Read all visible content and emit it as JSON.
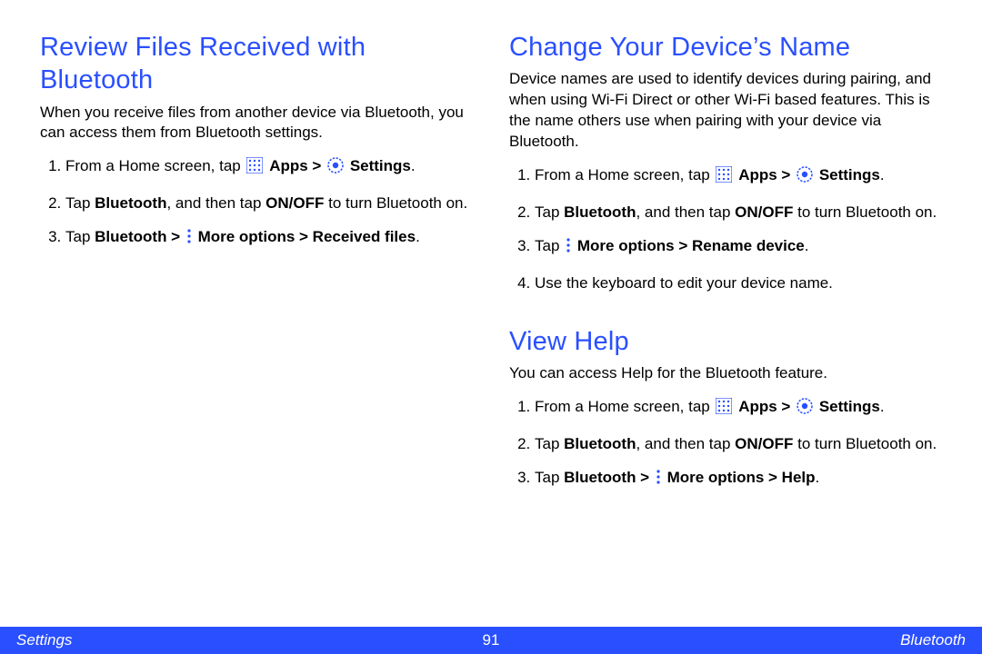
{
  "left": {
    "s1": {
      "title": "Review Files Received with Bluetooth",
      "intro": "When you receive files from another device via Bluetooth, you can access them from Bluetooth settings.",
      "step1_pre": "From a Home screen, tap ",
      "apps_label": "Apps",
      "gt": " > ",
      "settings_label": "Settings",
      "period": ".",
      "step2_pre": "Tap ",
      "step2_bt": "Bluetooth",
      "step2_mid": ", and then tap ",
      "step2_onoff": "ON/OFF",
      "step2_post": " to turn Bluetooth on.",
      "step3_pre": "Tap ",
      "step3_bt": "Bluetooth > ",
      "step3_more": "More options > Received files",
      "step3_period": "."
    }
  },
  "right": {
    "s1": {
      "title": "Change Your Device’s Name",
      "intro": "Device names are used to identify devices during pairing, and when using Wi-Fi Direct or other Wi-Fi based features. This is the name others use when pairing with your device via Bluetooth.",
      "step1_pre": "From a Home screen, tap ",
      "apps_label": "Apps",
      "gt": " > ",
      "settings_label": "Settings",
      "period": ".",
      "step2_pre": "Tap ",
      "step2_bt": "Bluetooth",
      "step2_mid": ", and then tap ",
      "step2_onoff": "ON/OFF",
      "step2_post": " to turn Bluetooth on.",
      "step3_pre": "Tap ",
      "step3_more": "More options > Rename device",
      "step3_period": ".",
      "step4": "Use the keyboard to edit your device name."
    },
    "s2": {
      "title": "View Help",
      "intro": "You can access Help for the Bluetooth feature.",
      "step1_pre": "From a Home screen, tap ",
      "apps_label": "Apps",
      "gt": " > ",
      "settings_label": "Settings",
      "period": ".",
      "step2_pre": "Tap ",
      "step2_bt": "Bluetooth",
      "step2_mid": ", and then tap ",
      "step2_onoff": "ON/OFF",
      "step2_post": " to turn Bluetooth on.",
      "step3_pre": "Tap ",
      "step3_bt": "Bluetooth > ",
      "step3_more": "More options > Help",
      "step3_period": "."
    }
  },
  "footer": {
    "left": "Settings",
    "center": "91",
    "right": "Bluetooth"
  }
}
